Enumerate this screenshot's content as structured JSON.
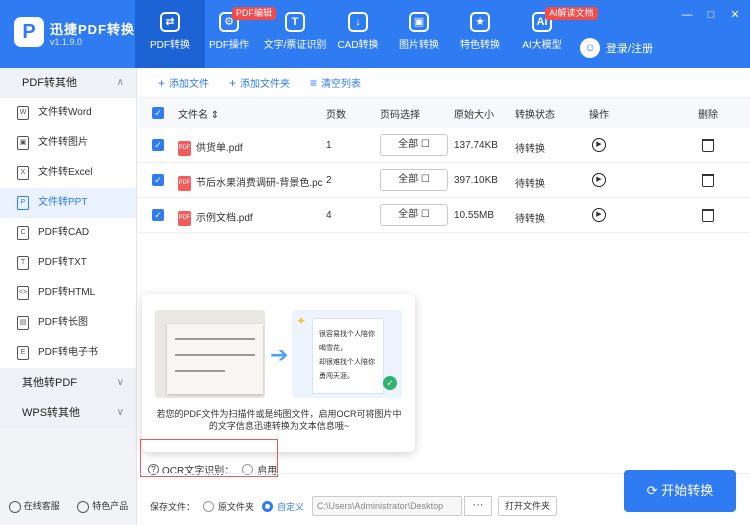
{
  "app": {
    "logo_glyph": "P",
    "name": "迅捷PDF转换器",
    "version": "v1.1.9.0"
  },
  "nav": [
    {
      "label": "PDF转换",
      "glyph": "⇄",
      "active": true
    },
    {
      "label": "PDF操作",
      "glyph": "⚙",
      "badge": "PDF编辑"
    },
    {
      "label": "文字/票证识别",
      "glyph": "T"
    },
    {
      "label": "CAD转换",
      "glyph": "↓"
    },
    {
      "label": "图片转换",
      "glyph": "▣"
    },
    {
      "label": "特色转换",
      "glyph": "★"
    },
    {
      "label": "AI大模型",
      "glyph": "AI",
      "badge": "AI解读文档"
    }
  ],
  "login": {
    "label": "登录/注册",
    "avatar_glyph": "☺"
  },
  "window": {
    "min": "—",
    "max": "□",
    "close": "✕"
  },
  "sidebar": {
    "groups": [
      {
        "label": "PDF转其他",
        "chevron": "∧",
        "items": [
          {
            "label": "文件转Word",
            "icon": "W"
          },
          {
            "label": "文件转图片",
            "icon": "▣"
          },
          {
            "label": "文件转Excel",
            "icon": "X"
          },
          {
            "label": "文件转PPT",
            "icon": "P",
            "active": true
          },
          {
            "label": "PDF转CAD",
            "icon": "C"
          },
          {
            "label": "PDF转TXT",
            "icon": "T"
          },
          {
            "label": "PDF转HTML",
            "icon": "<>"
          },
          {
            "label": "PDF转长图",
            "icon": "▤"
          },
          {
            "label": "PDF转电子书",
            "icon": "E"
          }
        ]
      },
      {
        "label": "其他转PDF",
        "chevron": "∨"
      },
      {
        "label": "WPS转其他",
        "chevron": "∨"
      }
    ],
    "footer": {
      "service": "在线客服",
      "products": "特色产品"
    }
  },
  "toolbar": {
    "add_file": "添加文件",
    "add_folder": "添加文件夹",
    "clear": "清空列表",
    "add_glyph": "+",
    "clear_glyph": "≡"
  },
  "table": {
    "headers": {
      "name": "文件名 ⇕",
      "pages": "页数",
      "page_select": "页码选择",
      "size": "原始大小",
      "status": "转换状态",
      "action": "操作",
      "delete": "删除"
    },
    "rows": [
      {
        "name": "供货单.pdf",
        "pages": "1",
        "page_select": "全部 ☐",
        "size": "137.74KB",
        "status": "待转换"
      },
      {
        "name": "节后水果消费调研-背景色.pc",
        "pages": "2",
        "page_select": "全部 ☐",
        "size": "397.10KB",
        "status": "待转换"
      },
      {
        "name": "示例文档.pdf",
        "pages": "4",
        "page_select": "全部 ☐",
        "size": "10.55MB",
        "status": "待转换"
      }
    ]
  },
  "ocr_popup": {
    "doc_lines": [
      "很容易找个人陪你",
      "喝雪花，",
      "却很难找个人陪你",
      "勇闯天涯。"
    ],
    "description": "若您的PDF文件为扫描件或是纯图文件，启用OCR可将图片中的文字信息迅速转换为文本信息哦~"
  },
  "ocr": {
    "label": "OCR文字识别：",
    "enable": "启用",
    "help": "?"
  },
  "save": {
    "label": "保存文件：",
    "source": "原文件夹",
    "custom": "自定义",
    "path": "C:\\Users\\Administrator\\Desktop",
    "browse": "···",
    "open": "打开文件夹"
  },
  "start_button": {
    "label": "开始转换",
    "glyph": "⟳"
  }
}
